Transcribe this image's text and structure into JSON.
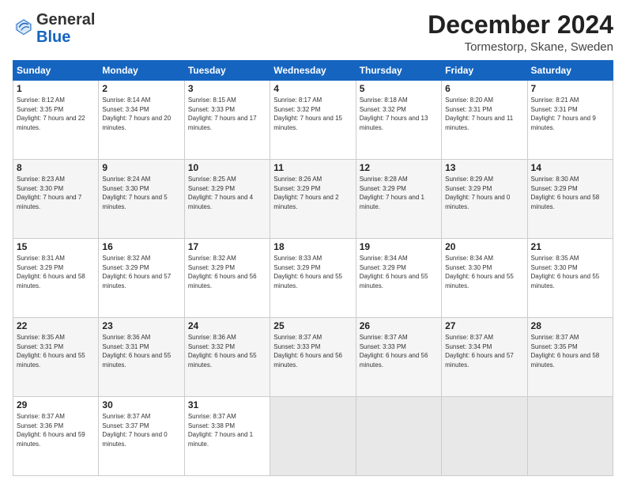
{
  "logo": {
    "general": "General",
    "blue": "Blue"
  },
  "header": {
    "month": "December 2024",
    "location": "Tormestorp, Skane, Sweden"
  },
  "weekdays": [
    "Sunday",
    "Monday",
    "Tuesday",
    "Wednesday",
    "Thursday",
    "Friday",
    "Saturday"
  ],
  "weeks": [
    [
      {
        "day": "1",
        "sunrise": "Sunrise: 8:12 AM",
        "sunset": "Sunset: 3:35 PM",
        "daylight": "Daylight: 7 hours and 22 minutes."
      },
      {
        "day": "2",
        "sunrise": "Sunrise: 8:14 AM",
        "sunset": "Sunset: 3:34 PM",
        "daylight": "Daylight: 7 hours and 20 minutes."
      },
      {
        "day": "3",
        "sunrise": "Sunrise: 8:15 AM",
        "sunset": "Sunset: 3:33 PM",
        "daylight": "Daylight: 7 hours and 17 minutes."
      },
      {
        "day": "4",
        "sunrise": "Sunrise: 8:17 AM",
        "sunset": "Sunset: 3:32 PM",
        "daylight": "Daylight: 7 hours and 15 minutes."
      },
      {
        "day": "5",
        "sunrise": "Sunrise: 8:18 AM",
        "sunset": "Sunset: 3:32 PM",
        "daylight": "Daylight: 7 hours and 13 minutes."
      },
      {
        "day": "6",
        "sunrise": "Sunrise: 8:20 AM",
        "sunset": "Sunset: 3:31 PM",
        "daylight": "Daylight: 7 hours and 11 minutes."
      },
      {
        "day": "7",
        "sunrise": "Sunrise: 8:21 AM",
        "sunset": "Sunset: 3:31 PM",
        "daylight": "Daylight: 7 hours and 9 minutes."
      }
    ],
    [
      {
        "day": "8",
        "sunrise": "Sunrise: 8:23 AM",
        "sunset": "Sunset: 3:30 PM",
        "daylight": "Daylight: 7 hours and 7 minutes."
      },
      {
        "day": "9",
        "sunrise": "Sunrise: 8:24 AM",
        "sunset": "Sunset: 3:30 PM",
        "daylight": "Daylight: 7 hours and 5 minutes."
      },
      {
        "day": "10",
        "sunrise": "Sunrise: 8:25 AM",
        "sunset": "Sunset: 3:29 PM",
        "daylight": "Daylight: 7 hours and 4 minutes."
      },
      {
        "day": "11",
        "sunrise": "Sunrise: 8:26 AM",
        "sunset": "Sunset: 3:29 PM",
        "daylight": "Daylight: 7 hours and 2 minutes."
      },
      {
        "day": "12",
        "sunrise": "Sunrise: 8:28 AM",
        "sunset": "Sunset: 3:29 PM",
        "daylight": "Daylight: 7 hours and 1 minute."
      },
      {
        "day": "13",
        "sunrise": "Sunrise: 8:29 AM",
        "sunset": "Sunset: 3:29 PM",
        "daylight": "Daylight: 7 hours and 0 minutes."
      },
      {
        "day": "14",
        "sunrise": "Sunrise: 8:30 AM",
        "sunset": "Sunset: 3:29 PM",
        "daylight": "Daylight: 6 hours and 58 minutes."
      }
    ],
    [
      {
        "day": "15",
        "sunrise": "Sunrise: 8:31 AM",
        "sunset": "Sunset: 3:29 PM",
        "daylight": "Daylight: 6 hours and 58 minutes."
      },
      {
        "day": "16",
        "sunrise": "Sunrise: 8:32 AM",
        "sunset": "Sunset: 3:29 PM",
        "daylight": "Daylight: 6 hours and 57 minutes."
      },
      {
        "day": "17",
        "sunrise": "Sunrise: 8:32 AM",
        "sunset": "Sunset: 3:29 PM",
        "daylight": "Daylight: 6 hours and 56 minutes."
      },
      {
        "day": "18",
        "sunrise": "Sunrise: 8:33 AM",
        "sunset": "Sunset: 3:29 PM",
        "daylight": "Daylight: 6 hours and 55 minutes."
      },
      {
        "day": "19",
        "sunrise": "Sunrise: 8:34 AM",
        "sunset": "Sunset: 3:29 PM",
        "daylight": "Daylight: 6 hours and 55 minutes."
      },
      {
        "day": "20",
        "sunrise": "Sunrise: 8:34 AM",
        "sunset": "Sunset: 3:30 PM",
        "daylight": "Daylight: 6 hours and 55 minutes."
      },
      {
        "day": "21",
        "sunrise": "Sunrise: 8:35 AM",
        "sunset": "Sunset: 3:30 PM",
        "daylight": "Daylight: 6 hours and 55 minutes."
      }
    ],
    [
      {
        "day": "22",
        "sunrise": "Sunrise: 8:35 AM",
        "sunset": "Sunset: 3:31 PM",
        "daylight": "Daylight: 6 hours and 55 minutes."
      },
      {
        "day": "23",
        "sunrise": "Sunrise: 8:36 AM",
        "sunset": "Sunset: 3:31 PM",
        "daylight": "Daylight: 6 hours and 55 minutes."
      },
      {
        "day": "24",
        "sunrise": "Sunrise: 8:36 AM",
        "sunset": "Sunset: 3:32 PM",
        "daylight": "Daylight: 6 hours and 55 minutes."
      },
      {
        "day": "25",
        "sunrise": "Sunrise: 8:37 AM",
        "sunset": "Sunset: 3:33 PM",
        "daylight": "Daylight: 6 hours and 56 minutes."
      },
      {
        "day": "26",
        "sunrise": "Sunrise: 8:37 AM",
        "sunset": "Sunset: 3:33 PM",
        "daylight": "Daylight: 6 hours and 56 minutes."
      },
      {
        "day": "27",
        "sunrise": "Sunrise: 8:37 AM",
        "sunset": "Sunset: 3:34 PM",
        "daylight": "Daylight: 6 hours and 57 minutes."
      },
      {
        "day": "28",
        "sunrise": "Sunrise: 8:37 AM",
        "sunset": "Sunset: 3:35 PM",
        "daylight": "Daylight: 6 hours and 58 minutes."
      }
    ],
    [
      {
        "day": "29",
        "sunrise": "Sunrise: 8:37 AM",
        "sunset": "Sunset: 3:36 PM",
        "daylight": "Daylight: 6 hours and 59 minutes."
      },
      {
        "day": "30",
        "sunrise": "Sunrise: 8:37 AM",
        "sunset": "Sunset: 3:37 PM",
        "daylight": "Daylight: 7 hours and 0 minutes."
      },
      {
        "day": "31",
        "sunrise": "Sunrise: 8:37 AM",
        "sunset": "Sunset: 3:38 PM",
        "daylight": "Daylight: 7 hours and 1 minute."
      },
      {
        "day": "",
        "sunrise": "",
        "sunset": "",
        "daylight": ""
      },
      {
        "day": "",
        "sunrise": "",
        "sunset": "",
        "daylight": ""
      },
      {
        "day": "",
        "sunrise": "",
        "sunset": "",
        "daylight": ""
      },
      {
        "day": "",
        "sunrise": "",
        "sunset": "",
        "daylight": ""
      }
    ]
  ]
}
